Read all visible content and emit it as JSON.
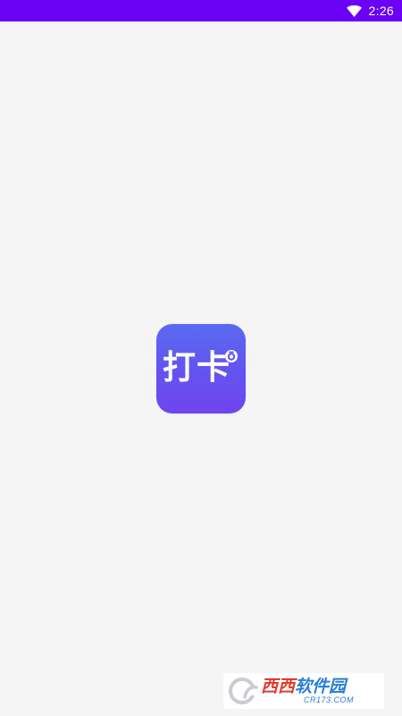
{
  "status_bar": {
    "time": "2:26",
    "background_color": "#6a00f4",
    "icons": [
      "wifi-icon"
    ]
  },
  "splash": {
    "background_color": "#f5f5f5",
    "app_icon": {
      "text": "打卡",
      "gradient_top": "#5a6af0",
      "gradient_bottom": "#6e45ee",
      "badge_icon": "camera-badge-icon"
    }
  },
  "watermark": {
    "title_part1": "西西",
    "title_part2": "软件园",
    "subtitle": "CR173.COM",
    "logo_icon": "cr-logo-icon"
  }
}
